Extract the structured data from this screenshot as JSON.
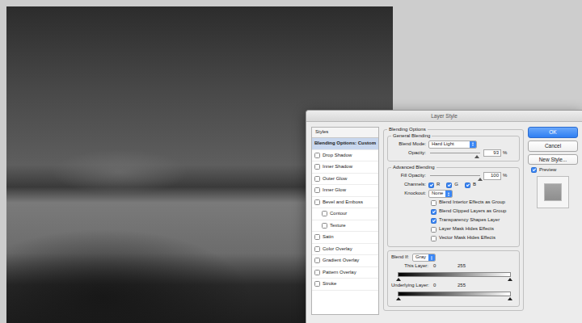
{
  "window": {
    "title": "Layer Style"
  },
  "styles": {
    "header": "Styles",
    "items": [
      {
        "label": "Blending Options: Custom",
        "kind": "plain",
        "checked": false,
        "selected": true
      },
      {
        "label": "Drop Shadow",
        "kind": "check",
        "checked": false,
        "selected": false
      },
      {
        "label": "Inner Shadow",
        "kind": "check",
        "checked": false,
        "selected": false
      },
      {
        "label": "Outer Glow",
        "kind": "check",
        "checked": false,
        "selected": false
      },
      {
        "label": "Inner Glow",
        "kind": "check",
        "checked": false,
        "selected": false
      },
      {
        "label": "Bevel and Emboss",
        "kind": "check",
        "checked": false,
        "selected": false
      },
      {
        "label": "Contour",
        "kind": "subcheck",
        "checked": false,
        "selected": false
      },
      {
        "label": "Texture",
        "kind": "subcheck",
        "checked": false,
        "selected": false
      },
      {
        "label": "Satin",
        "kind": "check",
        "checked": false,
        "selected": false
      },
      {
        "label": "Color Overlay",
        "kind": "check",
        "checked": false,
        "selected": false
      },
      {
        "label": "Gradient Overlay",
        "kind": "check",
        "checked": false,
        "selected": false
      },
      {
        "label": "Pattern Overlay",
        "kind": "check",
        "checked": false,
        "selected": false
      },
      {
        "label": "Stroke",
        "kind": "check",
        "checked": false,
        "selected": false
      }
    ]
  },
  "blending": {
    "title": "Blending Options",
    "general": {
      "title": "General Blending",
      "blend_mode": {
        "label": "Blend Mode:",
        "value": "Hard Light"
      },
      "opacity": {
        "label": "Opacity:",
        "level": 0.93,
        "value": "93",
        "unit": "%"
      }
    },
    "advanced": {
      "title": "Advanced Blending",
      "fill_opacity": {
        "label": "Fill Opacity:",
        "level": 1,
        "value": "100",
        "unit": "%"
      },
      "channels": {
        "label": "Channels:",
        "items": [
          {
            "label": "R",
            "checked": true
          },
          {
            "label": "G",
            "checked": true
          },
          {
            "label": "B",
            "checked": true
          }
        ]
      },
      "knockout": {
        "label": "Knockout:",
        "value": "None"
      },
      "options": [
        {
          "label": "Blend Interior Effects as Group",
          "checked": false
        },
        {
          "label": "Blend Clipped Layers as Group",
          "checked": true
        },
        {
          "label": "Transparency Shapes Layer",
          "checked": true
        },
        {
          "label": "Layer Mask Hides Effects",
          "checked": false
        },
        {
          "label": "Vector Mask Hides Effects",
          "checked": false
        }
      ]
    },
    "blend_if": {
      "label": "Blend If:",
      "value": "Gray",
      "this_layer": {
        "label": "This Layer:",
        "low": "0",
        "high": "255",
        "low_level": 0,
        "high_level": 1
      },
      "underlying": {
        "label": "Underlying Layer:",
        "low": "0",
        "high": "255",
        "low_level": 0,
        "high_level": 1
      }
    }
  },
  "buttons": [
    {
      "label": "OK",
      "default": true
    },
    {
      "label": "Cancel",
      "default": false
    },
    {
      "label": "New Style...",
      "default": false
    }
  ],
  "preview": {
    "label": "Preview",
    "checked": true
  }
}
